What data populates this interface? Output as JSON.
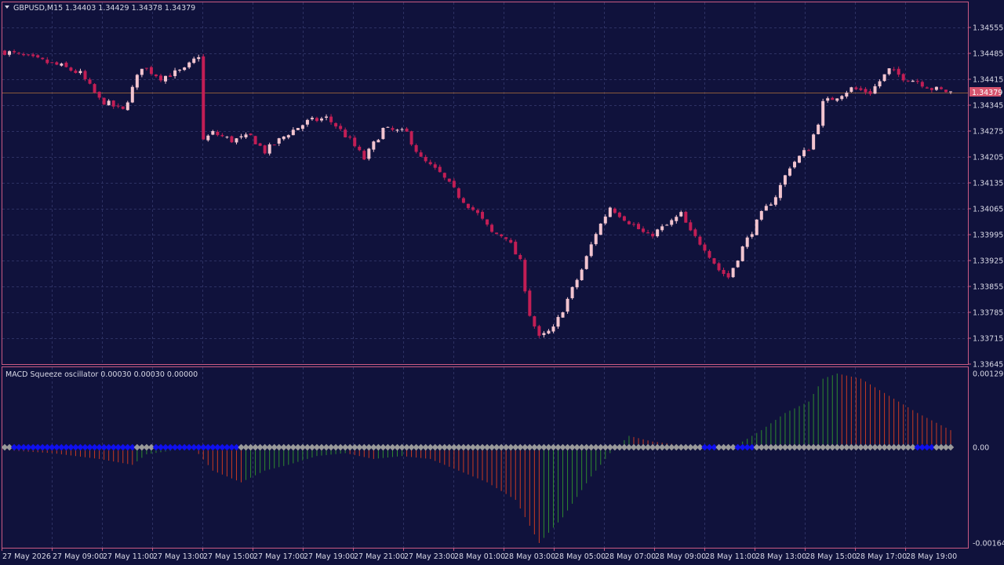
{
  "main_chart": {
    "symbol_timeframe": "GBPUSD,M15",
    "ohlc_readout": "1.34403 1.34429 1.34378 1.34379",
    "current_price_tag": "1.34379",
    "current_price": 1.34379,
    "price_axis_labels": [
      "1.34555",
      "1.34485",
      "1.34415",
      "1.34345",
      "1.34275",
      "1.34205",
      "1.34135",
      "1.34065",
      "1.33995",
      "1.33925",
      "1.33855",
      "1.33785",
      "1.33715",
      "1.33645"
    ],
    "price_range": [
      1.33645,
      1.34555
    ]
  },
  "indicator": {
    "name_readout": "MACD Squeeze oscillator 0.00030 0.00030 0.00000",
    "axis_labels": [
      "0.00129",
      "0.00",
      "-0.00164"
    ],
    "value_range": [
      -0.00164,
      0.00129
    ]
  },
  "time_axis": {
    "labels": [
      "27 May 2026",
      "27 May 09:00",
      "27 May 11:00",
      "27 May 13:00",
      "27 May 15:00",
      "27 May 17:00",
      "27 May 19:00",
      "27 May 21:00",
      "27 May 23:00",
      "28 May 01:00",
      "28 May 03:00",
      "28 May 05:00",
      "28 May 07:00",
      "28 May 09:00",
      "28 May 11:00",
      "28 May 13:00",
      "28 May 15:00",
      "28 May 17:00",
      "28 May 19:00"
    ]
  },
  "colors": {
    "background": "#10123c",
    "frame": "#c95a82",
    "bull_candle": "#f2c4cf",
    "bear_candle": "#c21e55",
    "grid": "#2d3163",
    "hist_up": "#2f8a2f",
    "hist_down": "#c83a23",
    "squeeze_on": "#1010ee",
    "squeeze_off": "#9a9a9a",
    "price_tag_bg": "#d8556f"
  },
  "icons": {
    "symbol_menu": "triangle-down-icon"
  }
}
